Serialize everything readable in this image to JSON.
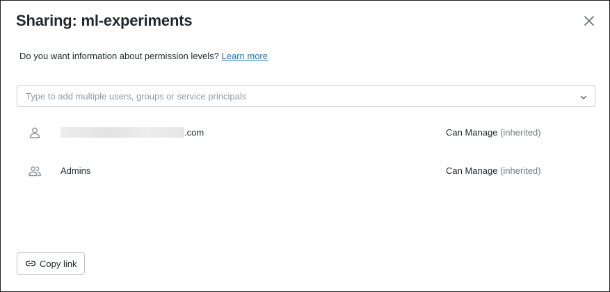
{
  "dialog": {
    "title": "Sharing: ml-experiments",
    "close_icon": "close-icon"
  },
  "info": {
    "question": "Do you want information about permission levels?",
    "link_label": "Learn more"
  },
  "search": {
    "placeholder": "Type to add multiple users, groups or service principals",
    "icon": "chevron-down-icon"
  },
  "principals": [
    {
      "icon": "user-icon",
      "name_suffix": ".com",
      "permission": "Can Manage",
      "inherited": "(inherited)"
    },
    {
      "icon": "group-icon",
      "name": "Admins",
      "permission": "Can Manage",
      "inherited": "(inherited)"
    }
  ],
  "footer": {
    "copy_link_label": "Copy link",
    "copy_link_icon": "link-icon"
  },
  "colors": {
    "link": "#2272b4",
    "text": "#1f272d",
    "muted": "#6f7a83",
    "border": "#cbcbcb"
  }
}
